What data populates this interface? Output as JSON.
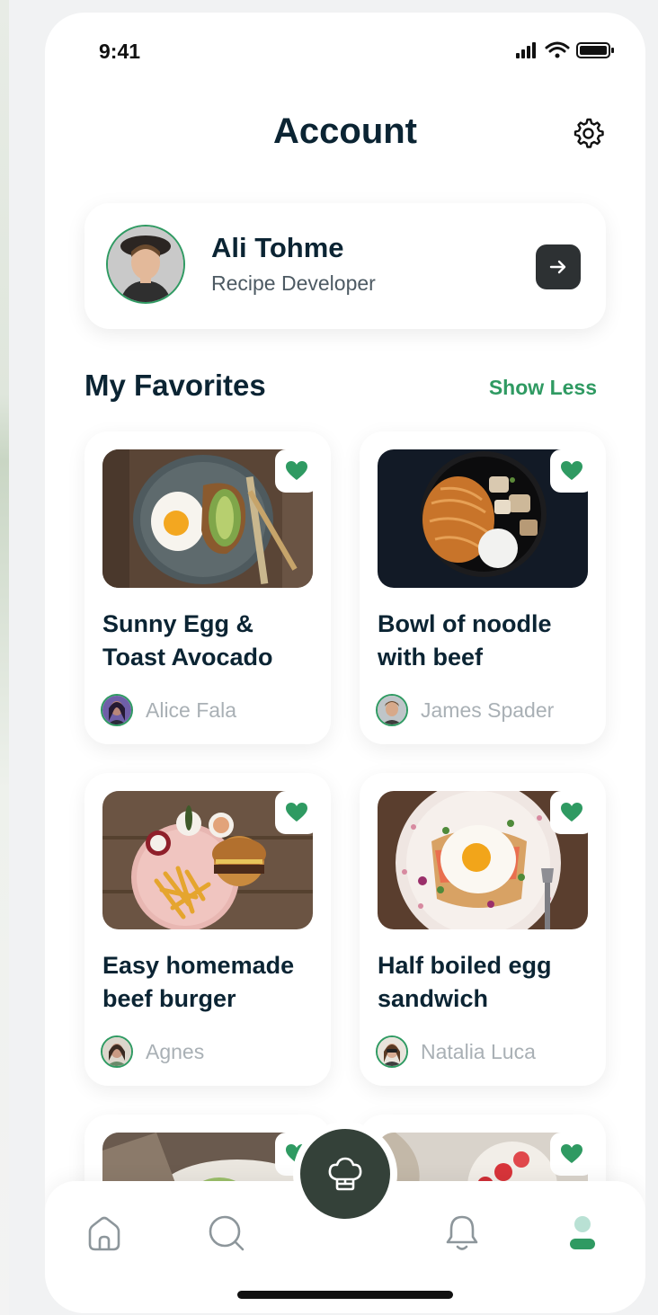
{
  "status_bar": {
    "time": "9:41"
  },
  "header": {
    "title": "Account"
  },
  "profile": {
    "name": "Ali Tohme",
    "role": "Recipe Developer"
  },
  "favorites": {
    "title": "My Favorites",
    "toggle_label": "Show Less",
    "items": [
      {
        "title": "Sunny Egg & Toast Avocado",
        "author": "Alice Fala"
      },
      {
        "title": "Bowl of noodle with beef",
        "author": "James Spader"
      },
      {
        "title": "Easy homemade beef burger",
        "author": "Agnes"
      },
      {
        "title": "Half boiled egg sandwich",
        "author": "Natalia Luca"
      }
    ]
  },
  "bottom_nav": {
    "items": [
      "home-icon",
      "search-icon",
      "chef-hat-icon",
      "bell-icon",
      "profile-icon"
    ],
    "active": "profile-icon"
  },
  "colors": {
    "accent": "#2f9a62",
    "title_text": "#0b2433",
    "muted_text": "#a9b0b5",
    "dark_button": "#2d3133",
    "fab": "#344139"
  }
}
